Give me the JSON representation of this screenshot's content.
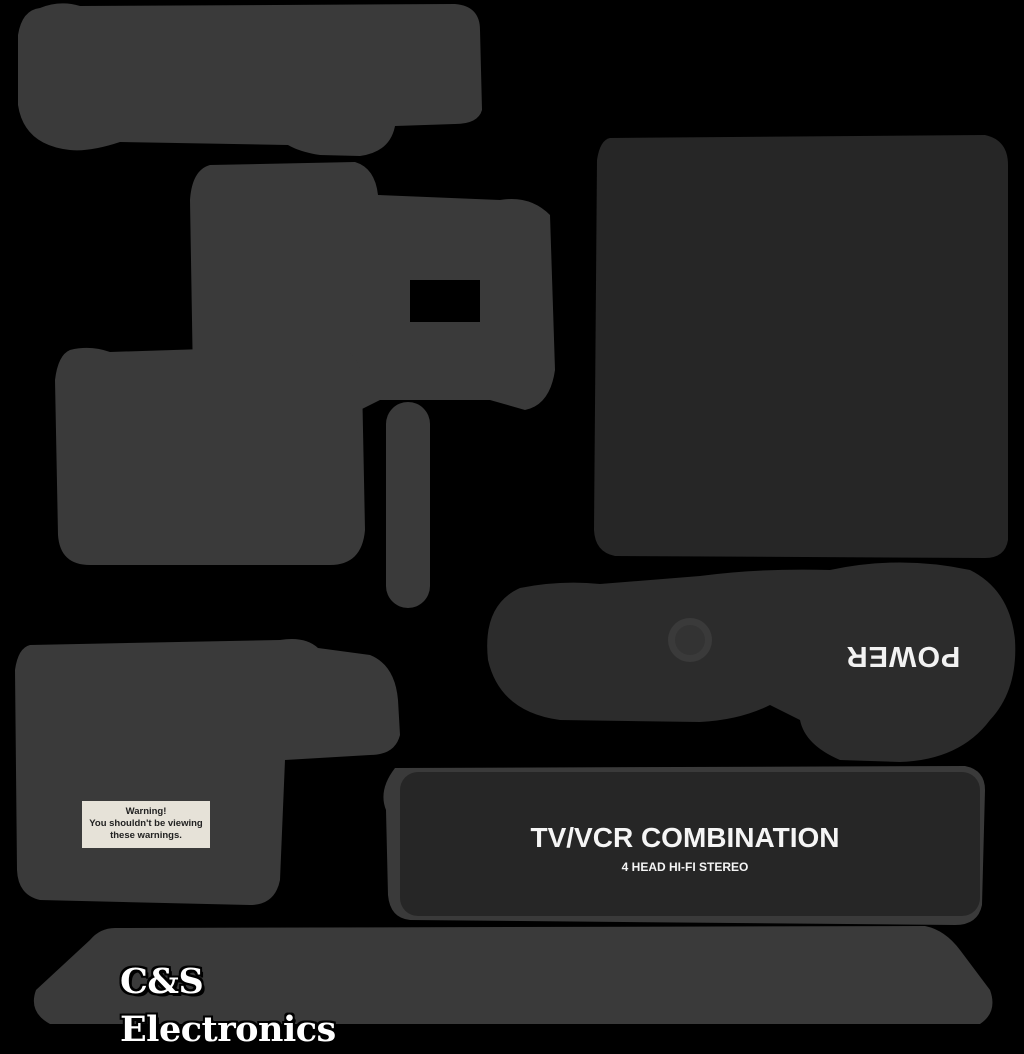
{
  "texture": {
    "background_color": "#000000",
    "patch_color": "#3a3a3a",
    "dark_patch_color": "#262626",
    "power_label": "POWER",
    "warning": {
      "line1": "Warning!",
      "line2": "You shouldn't be viewing",
      "line3": "these warnings."
    },
    "model_title": "TV/VCR COMBINATION",
    "model_subtitle": "4 HEAD HI-FI STEREO",
    "brand": "C&S Electronics",
    "power_button_icon": "round-button-icon"
  }
}
